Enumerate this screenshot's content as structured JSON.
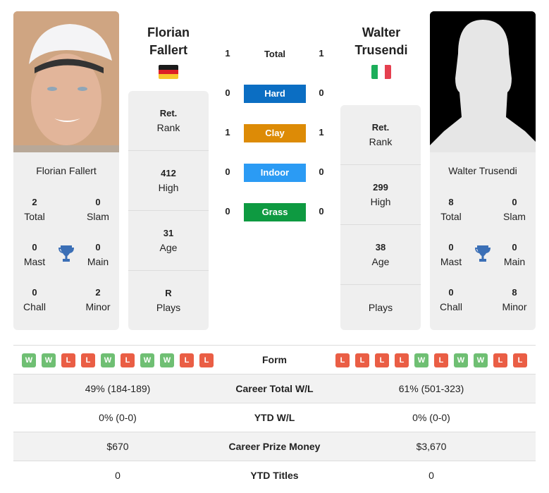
{
  "colors": {
    "hard": "#0b6ec3",
    "clay": "#dd8b06",
    "indoor": "#2b9bf4",
    "grass": "#0e9a41",
    "win": "#6fbf73",
    "loss": "#ea5e45",
    "trophy": "#3b6fb6"
  },
  "player_left": {
    "name_line1": "Florian",
    "name_line2": "Fallert",
    "full_name": "Florian Fallert",
    "country_flag": "germany-flag",
    "titles": {
      "total": {
        "value": "2",
        "label": "Total"
      },
      "slam": {
        "value": "0",
        "label": "Slam"
      },
      "mast": {
        "value": "0",
        "label": "Mast"
      },
      "main": {
        "value": "0",
        "label": "Main"
      },
      "chall": {
        "value": "0",
        "label": "Chall"
      },
      "minor": {
        "value": "2",
        "label": "Minor"
      }
    },
    "rank": {
      "value": "Ret.",
      "label": "Rank"
    },
    "high": {
      "value": "412",
      "label": "High"
    },
    "age": {
      "value": "31",
      "label": "Age"
    },
    "plays": {
      "value": "R",
      "label": "Plays"
    },
    "form": [
      "W",
      "W",
      "L",
      "L",
      "W",
      "L",
      "W",
      "W",
      "L",
      "L"
    ]
  },
  "player_right": {
    "name_line1": "Walter",
    "name_line2": "Trusendi",
    "full_name": "Walter Trusendi",
    "country_flag": "italy-flag",
    "titles": {
      "total": {
        "value": "8",
        "label": "Total"
      },
      "slam": {
        "value": "0",
        "label": "Slam"
      },
      "mast": {
        "value": "0",
        "label": "Mast"
      },
      "main": {
        "value": "0",
        "label": "Main"
      },
      "chall": {
        "value": "0",
        "label": "Chall"
      },
      "minor": {
        "value": "8",
        "label": "Minor"
      }
    },
    "rank": {
      "value": "Ret.",
      "label": "Rank"
    },
    "high": {
      "value": "299",
      "label": "High"
    },
    "age": {
      "value": "38",
      "label": "Age"
    },
    "plays": {
      "value": "",
      "label": "Plays"
    },
    "form": [
      "L",
      "L",
      "L",
      "L",
      "W",
      "L",
      "W",
      "W",
      "L",
      "L"
    ]
  },
  "h2h": [
    {
      "label": "Total",
      "left": "1",
      "right": "1",
      "surface": "total"
    },
    {
      "label": "Hard",
      "left": "0",
      "right": "0",
      "surface": "hard"
    },
    {
      "label": "Clay",
      "left": "1",
      "right": "1",
      "surface": "clay"
    },
    {
      "label": "Indoor",
      "left": "0",
      "right": "0",
      "surface": "indoor"
    },
    {
      "label": "Grass",
      "left": "0",
      "right": "0",
      "surface": "grass"
    }
  ],
  "comparison": {
    "form_label": "Form",
    "rows": [
      {
        "label": "Career Total W/L",
        "left": "49% (184-189)",
        "right": "61% (501-323)"
      },
      {
        "label": "YTD W/L",
        "left": "0% (0-0)",
        "right": "0% (0-0)"
      },
      {
        "label": "Career Prize Money",
        "left": "$670",
        "right": "$3,670"
      },
      {
        "label": "YTD Titles",
        "left": "0",
        "right": "0"
      }
    ]
  }
}
